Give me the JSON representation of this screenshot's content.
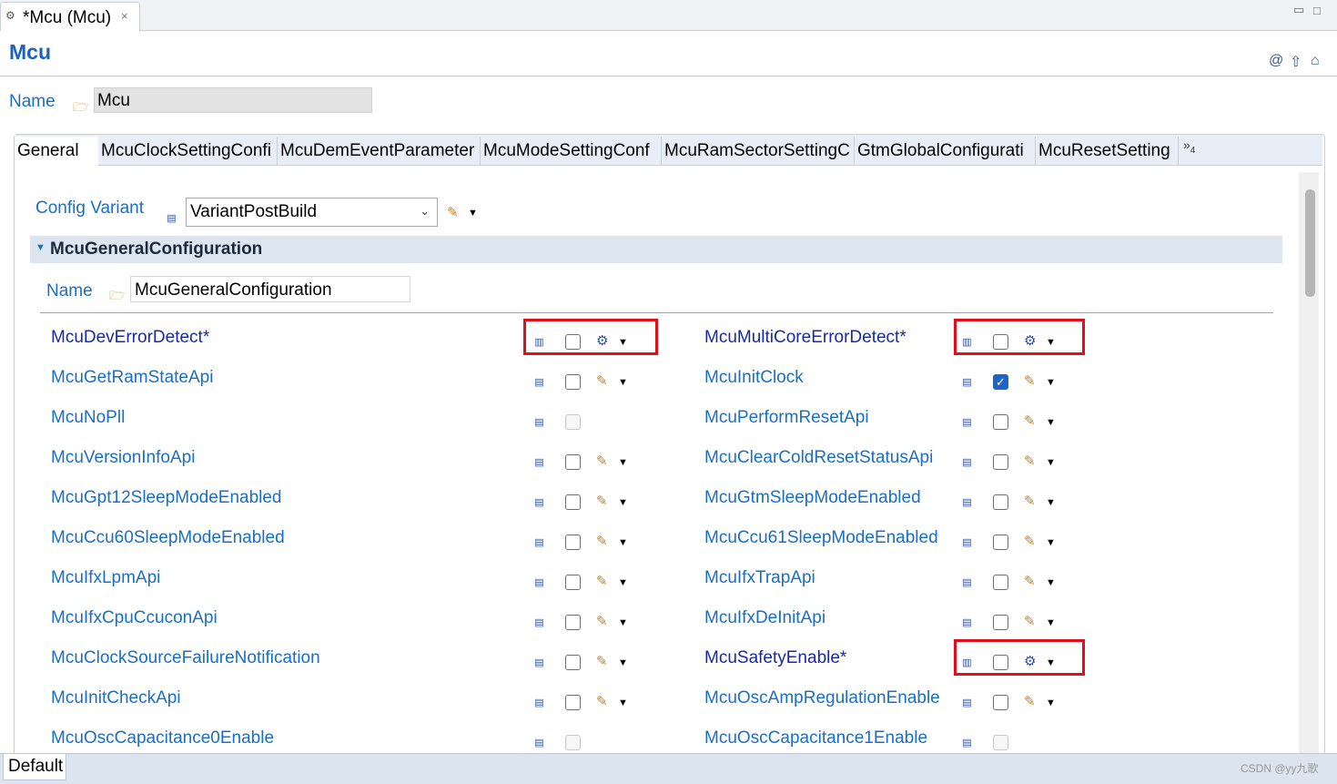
{
  "editor": {
    "tab_title": "*Mcu (Mcu)",
    "close_glyph": "×",
    "minimize_glyph": "▭",
    "maximize_glyph": "□"
  },
  "header": {
    "title": "Mcu",
    "icons": [
      "at-icon",
      "up-arrow-icon",
      "home-icon"
    ]
  },
  "name_row": {
    "label": "Name",
    "value": "Mcu"
  },
  "tabs": [
    {
      "label": "General",
      "active": true
    },
    {
      "label": "McuClockSettingConfi"
    },
    {
      "label": "McuDemEventParameter"
    },
    {
      "label": "McuModeSettingConf"
    },
    {
      "label": "McuRamSectorSettingC"
    },
    {
      "label": "GtmGlobalConfigurati"
    },
    {
      "label": "McuResetSetting"
    }
  ],
  "tabs_more": {
    "glyph": "»",
    "count": "4"
  },
  "config_variant": {
    "label": "Config Variant",
    "value": "VariantPostBuild"
  },
  "section": {
    "title": "McuGeneralConfiguration",
    "name_label": "Name",
    "name_value": "McuGeneralConfiguration"
  },
  "params_left": [
    {
      "label": "McuDevErrorDetect*",
      "checked": false,
      "edit": "calc",
      "highlight": true
    },
    {
      "label": "McuGetRamStateApi",
      "checked": false,
      "edit": "pencil"
    },
    {
      "label": "McuNoPll",
      "checked": false,
      "edit": "none",
      "disabled": true
    },
    {
      "label": "McuVersionInfoApi",
      "checked": false,
      "edit": "pencil"
    },
    {
      "label": "McuGpt12SleepModeEnabled",
      "checked": false,
      "edit": "pencil"
    },
    {
      "label": "McuCcu60SleepModeEnabled",
      "checked": false,
      "edit": "pencil"
    },
    {
      "label": "McuIfxLpmApi",
      "checked": false,
      "edit": "pencil"
    },
    {
      "label": "McuIfxCpuCcuconApi",
      "checked": false,
      "edit": "pencil"
    },
    {
      "label": "McuClockSourceFailureNotification",
      "checked": false,
      "edit": "pencil"
    },
    {
      "label": "McuInitCheckApi",
      "checked": false,
      "edit": "pencil"
    },
    {
      "label": "McuOscCapacitance0Enable",
      "checked": false,
      "edit": "none",
      "disabled": true
    }
  ],
  "params_right": [
    {
      "label": "McuMultiCoreErrorDetect*",
      "checked": false,
      "edit": "calc",
      "highlight": true
    },
    {
      "label": "McuInitClock",
      "checked": true,
      "edit": "pencil"
    },
    {
      "label": "McuPerformResetApi",
      "checked": false,
      "edit": "pencil"
    },
    {
      "label": "McuClearColdResetStatusApi",
      "checked": false,
      "edit": "pencil"
    },
    {
      "label": "McuGtmSleepModeEnabled",
      "checked": false,
      "edit": "pencil"
    },
    {
      "label": "McuCcu61SleepModeEnabled",
      "checked": false,
      "edit": "pencil"
    },
    {
      "label": "McuIfxTrapApi",
      "checked": false,
      "edit": "pencil"
    },
    {
      "label": "McuIfxDeInitApi",
      "checked": false,
      "edit": "pencil"
    },
    {
      "label": "McuSafetyEnable*",
      "checked": false,
      "edit": "calc",
      "highlight": true
    },
    {
      "label": "McuOscAmpRegulationEnable",
      "checked": false,
      "edit": "pencil"
    },
    {
      "label": "McuOscCapacitance1Enable",
      "checked": false,
      "edit": "none",
      "disabled": true
    }
  ],
  "bottom": {
    "tab": "Default",
    "watermark": "CSDN @yy九歌"
  }
}
